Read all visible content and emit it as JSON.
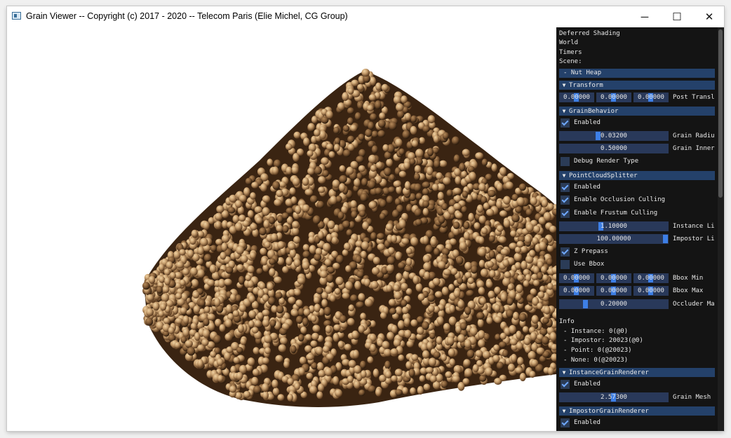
{
  "window": {
    "title": "Grain Viewer -- Copyright (c) 2017 - 2020 -- Telecom Paris (Elie Michel, CG Group)",
    "controls": {
      "minimize": "─",
      "maximize": "☐",
      "close": "✕"
    }
  },
  "panel": {
    "top_items": [
      "Deferred Shading",
      "World",
      "Timers",
      "Scene:"
    ],
    "scene_selected": "- Nut Heap",
    "transform": {
      "header": "Transform",
      "values": [
        "0.00000",
        "0.00000",
        "0.00000"
      ],
      "label": "Post Transl"
    },
    "grain_behavior": {
      "header": "GrainBehavior",
      "enabled_label": "Enabled",
      "grain_radius": {
        "value": "0.03200",
        "label": "Grain Radiu"
      },
      "grain_inner": {
        "value": "0.50000",
        "label": "Grain Inner"
      },
      "debug_label": "Debug Render Type"
    },
    "point_cloud_splitter": {
      "header": "PointCloudSplitter",
      "enabled_label": "Enabled",
      "occlusion_label": "Enable Occlusion Culling",
      "frustum_label": "Enable Frustum Culling",
      "instance_limit": {
        "value": "1.10000",
        "label": "Instance Li"
      },
      "impostor_limit": {
        "value": "100.00000",
        "label": "Impostor Li"
      },
      "z_prepass_label": "Z Prepass",
      "use_bbox_label": "Use Bbox",
      "bbox_min": {
        "values": [
          "0.00000",
          "0.00000",
          "0.00000"
        ],
        "label": "Bbox Min"
      },
      "bbox_max": {
        "values": [
          "0.00000",
          "0.00000",
          "0.00000"
        ],
        "label": "Bbox Max"
      },
      "occluder": {
        "value": "0.20000",
        "label": "Occluder Ma"
      }
    },
    "info": {
      "title": "Info",
      "lines": [
        "- Instance: 0(@0)",
        "- Impostor: 20023(@0)",
        "- Point: 0(@20023)",
        "- None: 0(@20023)"
      ]
    },
    "instance_renderer": {
      "header": "InstanceGrainRenderer",
      "enabled_label": "Enabled",
      "grain_mesh": {
        "value": "2.57300",
        "label": "Grain Mesh"
      }
    },
    "impostor_renderer": {
      "header": "ImpostorGrainRenderer",
      "enabled_label": "Enabled"
    }
  },
  "colors": {
    "panel_bg": "#141414",
    "header_bg": "#24416a",
    "field_bg": "#29395a",
    "accent": "#3d7fe6",
    "grain_light": "#c9a06f",
    "grain_dark": "#5a3a1e"
  }
}
